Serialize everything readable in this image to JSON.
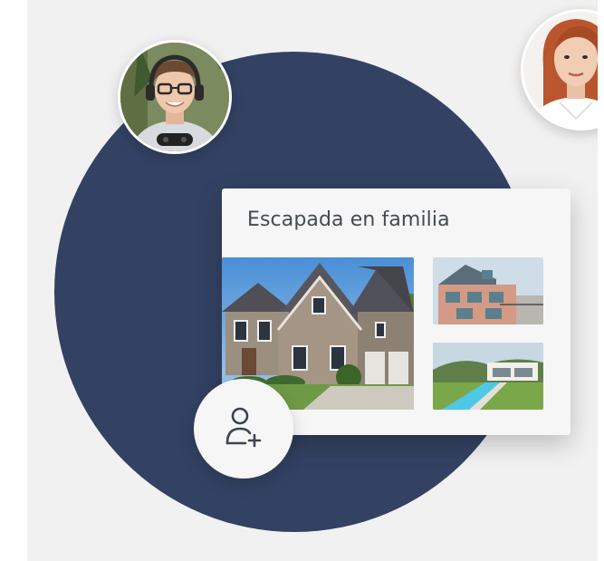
{
  "board": {
    "title": "Escapada en familia"
  },
  "icons": {
    "add_collaborator": "add-user-icon"
  },
  "colors": {
    "circle": "#334263",
    "background": "#f1f1f1",
    "card": "#f6f6f6",
    "title_text": "#444a50"
  }
}
